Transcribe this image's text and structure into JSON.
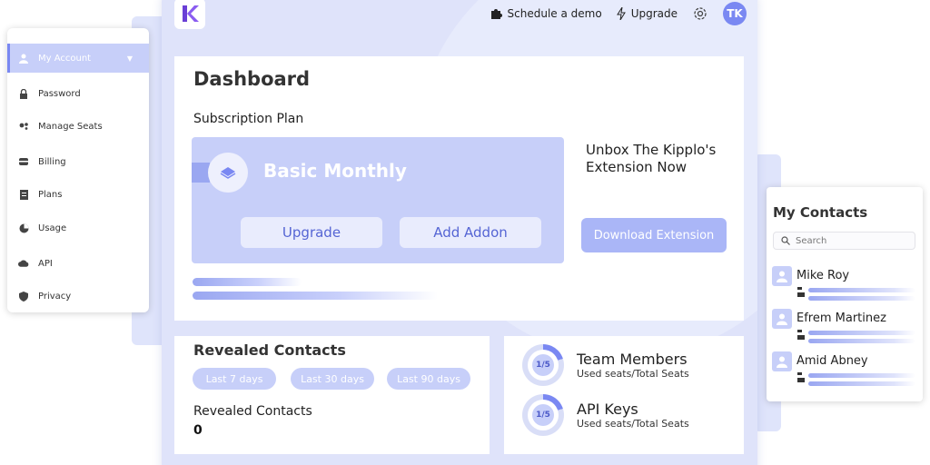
{
  "header": {
    "schedule_label": "Schedule a demo",
    "upgrade_label": "Upgrade",
    "avatar_initials": "TK"
  },
  "sidebar": {
    "items": [
      {
        "label": "My Account",
        "icon": "user-icon",
        "active": true
      },
      {
        "label": "Password",
        "icon": "lock-icon"
      },
      {
        "label": "Manage Seats",
        "icon": "seats-icon"
      },
      {
        "label": "Billing",
        "icon": "billing-icon"
      },
      {
        "label": "Plans",
        "icon": "plans-icon"
      },
      {
        "label": "Usage",
        "icon": "usage-icon"
      },
      {
        "label": "API",
        "icon": "cloud-icon"
      },
      {
        "label": "Privacy",
        "icon": "shield-icon"
      }
    ]
  },
  "dashboard": {
    "title": "Dashboard",
    "subscription_label": "Subscription Plan",
    "plan_name": "Basic Monthly",
    "upgrade_button": "Upgrade",
    "addon_button": "Add Addon",
    "extension_promo": "Unbox The Kipplo's Extension Now",
    "download_button": "Download Extension"
  },
  "revealed": {
    "title": "Revealed Contacts",
    "filters": [
      "Last 7 days",
      "Last 30 days",
      "Last 90 days"
    ],
    "count_label": "Revealed Contacts",
    "count_value": "0"
  },
  "stats": {
    "team": {
      "title": "Team Members",
      "subtitle": "Used seats/Total Seats",
      "ratio": "1/5"
    },
    "api": {
      "title": "API Keys",
      "subtitle": "Used seats/Total Seats",
      "ratio": "1/5"
    }
  },
  "contacts": {
    "title": "My Contacts",
    "search_placeholder": "Search",
    "items": [
      {
        "name": "Mike Roy"
      },
      {
        "name": "Efrem Martinez"
      },
      {
        "name": "Amid Abney"
      }
    ]
  },
  "colors": {
    "accent": "#7a88f2",
    "accent_light": "#c7cff9",
    "frame": "#dfe3fa"
  }
}
